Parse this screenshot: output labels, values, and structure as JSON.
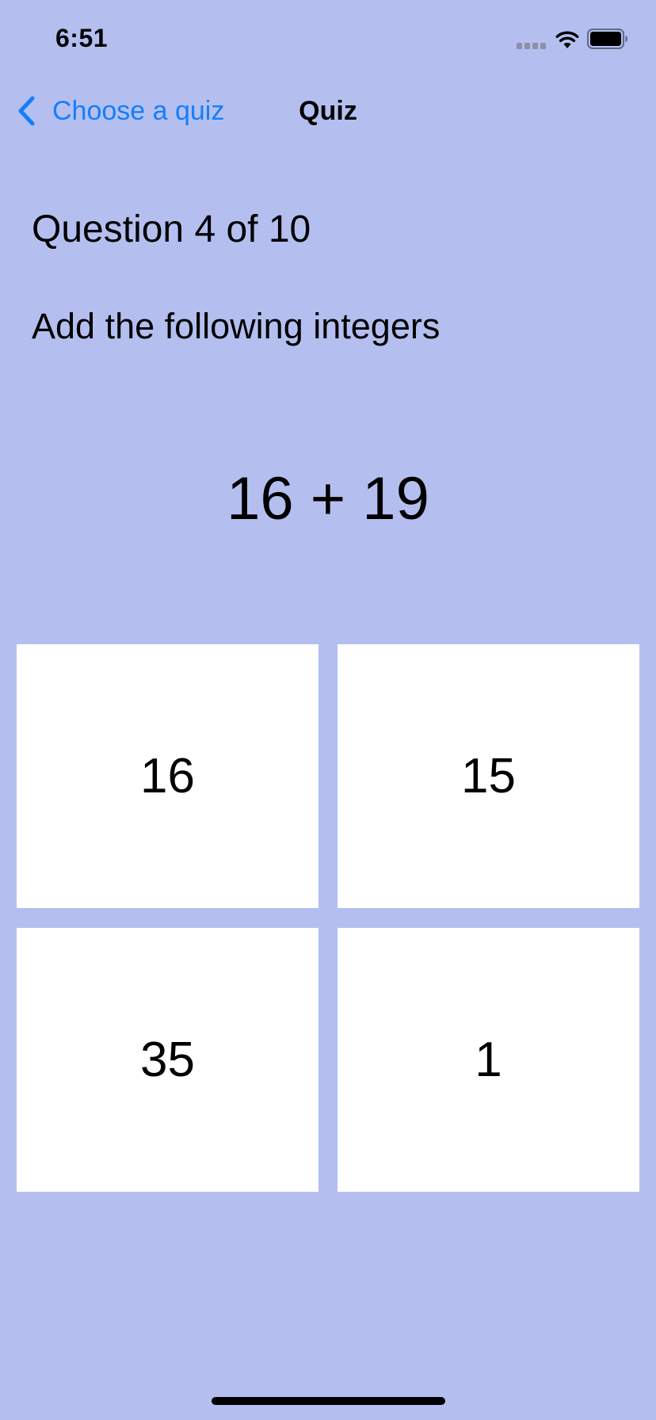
{
  "colors": {
    "background": "#b4bff0",
    "accent": "#147efb",
    "tile_background": "#ffffff",
    "text": "#000000"
  },
  "status_bar": {
    "time": "6:51",
    "icons": [
      "cellular-signal-icon",
      "wifi-icon",
      "battery-icon"
    ]
  },
  "nav_bar": {
    "back_icon": "chevron-left-icon",
    "back_label": "Choose a quiz",
    "title": "Quiz"
  },
  "question": {
    "counter": "Question 4 of 10",
    "instruction": "Add the following integers",
    "problem": "16 + 19"
  },
  "answers": [
    {
      "label": "16"
    },
    {
      "label": "15"
    },
    {
      "label": "35"
    },
    {
      "label": "1"
    }
  ]
}
